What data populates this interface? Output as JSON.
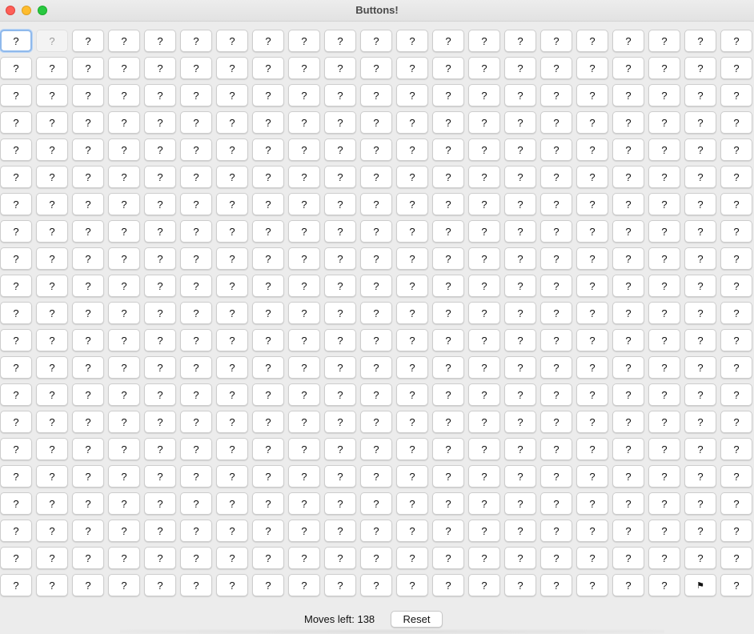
{
  "window": {
    "title": "Buttons!"
  },
  "grid": {
    "columns": 21,
    "rows": 21,
    "default_label": "?",
    "special_cells": [
      {
        "row": 0,
        "col": 0,
        "label": "?",
        "state": "focused"
      },
      {
        "row": 0,
        "col": 1,
        "label": "?",
        "state": "disabled"
      },
      {
        "row": 20,
        "col": 19,
        "label": "⚑",
        "state": "flagged"
      }
    ]
  },
  "footer": {
    "moves_text": "Moves left: 138",
    "reset_label": "Reset"
  },
  "colors": {
    "focus_ring": "#8fb9ec",
    "close": "#fe5f57",
    "minimize": "#febc2e",
    "maximize": "#28c840"
  }
}
